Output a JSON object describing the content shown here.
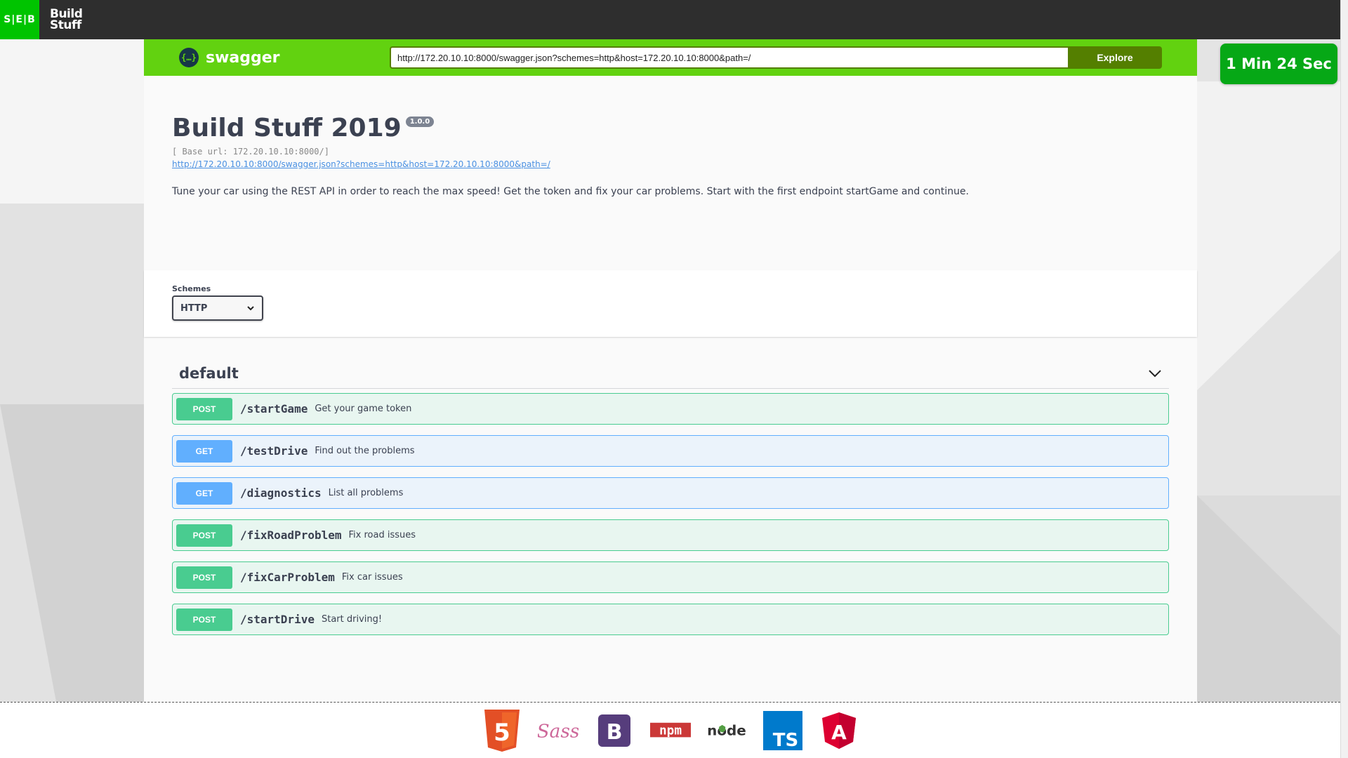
{
  "topbar": {
    "seb_logo": "S|E|B",
    "buildstuff_logo_line1": "Build",
    "buildstuff_logo_line2": "Stuff"
  },
  "swagger": {
    "logo_text": "swagger",
    "logo_icon": "{…}",
    "url_value": "http://172.20.10.10:8000/swagger.json?schemes=http&host=172.20.10.10:8000&path=/",
    "explore_label": "Explore"
  },
  "timer": {
    "text": "1 Min 24 Sec"
  },
  "info": {
    "title": "Build Stuff 2019",
    "version": "1.0.0",
    "base_url": "[ Base url: 172.20.10.10:8000/]",
    "spec_link": "http://172.20.10.10:8000/swagger.json?schemes=http&host=172.20.10.10:8000&path=/",
    "description": "Tune your car using the REST API in order to reach the max speed! Get the token and fix your car problems. Start with the first endpoint startGame and continue."
  },
  "schemes": {
    "label": "Schemes",
    "selected": "HTTP"
  },
  "tag": {
    "name": "default"
  },
  "operations": [
    {
      "method": "POST",
      "path": "/startGame",
      "summary": "Get your game token"
    },
    {
      "method": "GET",
      "path": "/testDrive",
      "summary": "Find out the problems"
    },
    {
      "method": "GET",
      "path": "/diagnostics",
      "summary": "List all problems"
    },
    {
      "method": "POST",
      "path": "/fixRoadProblem",
      "summary": "Fix road issues"
    },
    {
      "method": "POST",
      "path": "/fixCarProblem",
      "summary": "Fix car issues"
    },
    {
      "method": "POST",
      "path": "/startDrive",
      "summary": "Start driving!"
    }
  ],
  "footer_logos": [
    "html5-icon",
    "sass-icon",
    "bootstrap-icon",
    "npm-icon",
    "node-icon",
    "typescript-icon",
    "angular-icon"
  ],
  "colors": {
    "swagger_green": "#62d210",
    "post": "#49cc90",
    "get": "#61affe",
    "timer": "#06a816"
  }
}
